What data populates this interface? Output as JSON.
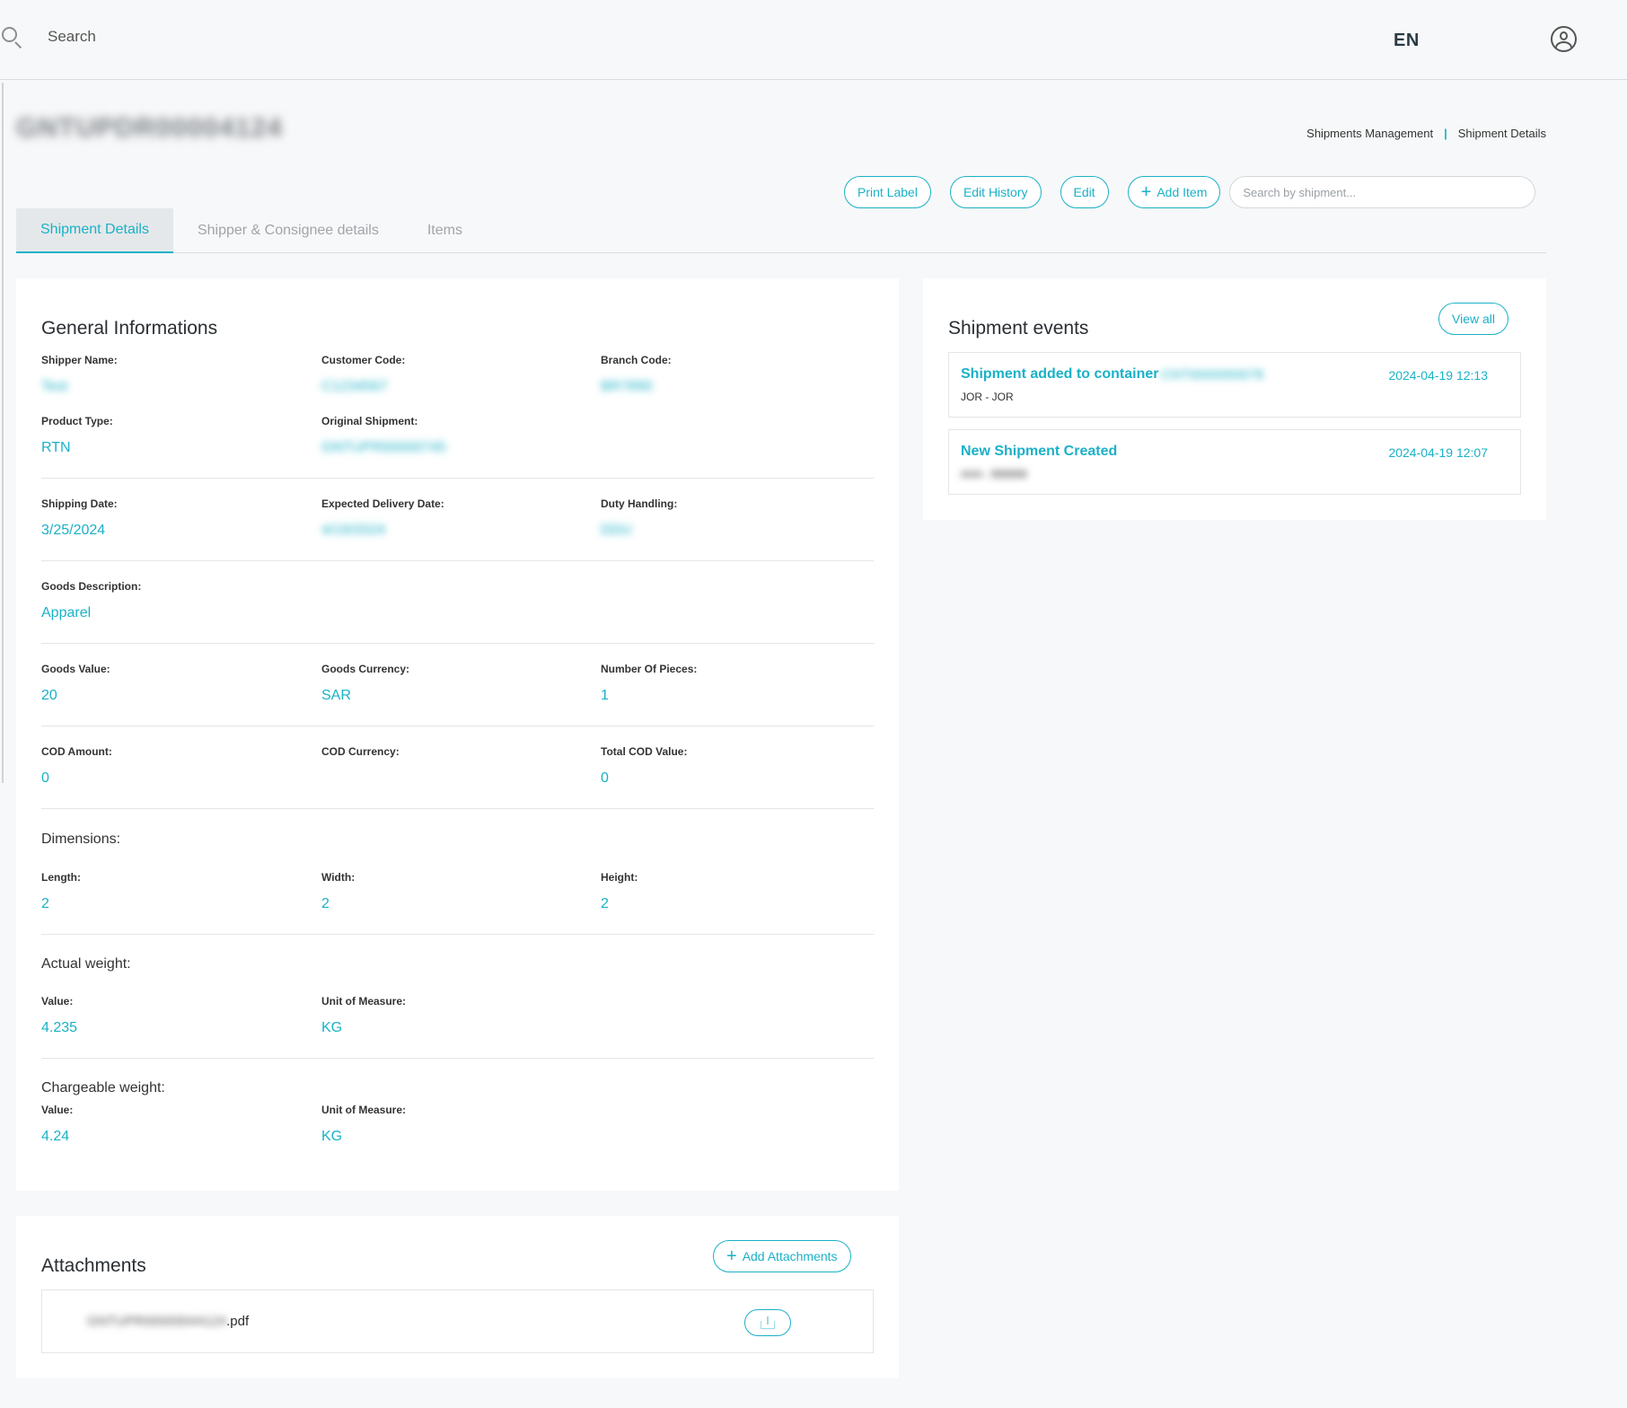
{
  "topbar": {
    "search_placeholder": "Search",
    "language": "EN",
    "icons": {
      "search": "search-icon",
      "user": "user-icon"
    }
  },
  "header": {
    "shipment_id": "GNTUPDR00004124",
    "breadcrumb": [
      "Shipments Management",
      "Shipment Details"
    ],
    "breadcrumb_separator": "|"
  },
  "actions": {
    "print_label": "Print Label",
    "edit_history": "Edit History",
    "edit": "Edit",
    "add_item": "Add Item",
    "shipment_search_placeholder": "Search by shipment..."
  },
  "tabs": [
    {
      "label": "Shipment Details",
      "active": true
    },
    {
      "label": "Shipper & Consignee details",
      "active": false
    },
    {
      "label": "Items",
      "active": false
    }
  ],
  "general": {
    "title": "General Informations",
    "shipper_name": {
      "label": "Shipper Name:",
      "value": "Test"
    },
    "customer_code": {
      "label": "Customer Code:",
      "value": "C1234567"
    },
    "branch_code": {
      "label": "Branch Code:",
      "value": "BR7890"
    },
    "product_type": {
      "label": "Product Type:",
      "value": "RTN"
    },
    "original_shipment": {
      "label": "Original Shipment:",
      "value": "GNTUPR00000745"
    },
    "shipping_date": {
      "label": "Shipping Date:",
      "value": "3/25/2024"
    },
    "expected_delivery": {
      "label": "Expected Delivery Date:",
      "value": "4/19/2024"
    },
    "duty_handling": {
      "label": "Duty Handling:",
      "value": "DDU"
    },
    "goods_description": {
      "label": "Goods Description:",
      "value": "Apparel"
    },
    "goods_value": {
      "label": "Goods Value:",
      "value": "20"
    },
    "goods_currency": {
      "label": "Goods Currency:",
      "value": "SAR"
    },
    "number_of_pieces": {
      "label": "Number Of Pieces:",
      "value": "1"
    },
    "cod_amount": {
      "label": "COD Amount:",
      "value": "0"
    },
    "cod_currency": {
      "label": "COD Currency:",
      "value": ""
    },
    "total_cod_value": {
      "label": "Total COD Value:",
      "value": "0"
    },
    "dimensions": {
      "title": "Dimensions:",
      "length": {
        "label": "Length:",
        "value": "2"
      },
      "width": {
        "label": "Width:",
        "value": "2"
      },
      "height": {
        "label": "Height:",
        "value": "2"
      }
    },
    "actual_weight": {
      "title": "Actual weight:",
      "value": {
        "label": "Value:",
        "value": "4.235"
      },
      "unit": {
        "label": "Unit of Measure:",
        "value": "KG"
      }
    },
    "chargeable_weight": {
      "title": "Chargeable weight:",
      "value": {
        "label": "Value:",
        "value": "4.24"
      },
      "unit": {
        "label": "Unit of Measure:",
        "value": "KG"
      }
    }
  },
  "events": {
    "title": "Shipment events",
    "view_all": "View all",
    "items": [
      {
        "title": "Shipment added to container",
        "container_id": "CNT0000000078",
        "sub": "JOR - JOR",
        "time": "2024-04-19 12:13"
      },
      {
        "title": "New Shipment Created",
        "container_id": "",
        "sub": "AAA - BBBBB",
        "time": "2024-04-19 12:07"
      }
    ]
  },
  "attachments": {
    "title": "Attachments",
    "add_label": "Add Attachments",
    "file_base": "GNTUPR00000044124",
    "file_ext": "pdf"
  },
  "colors": {
    "accent": "#1ab1c7",
    "background": "#f7f8f9",
    "card": "#ffffff"
  }
}
